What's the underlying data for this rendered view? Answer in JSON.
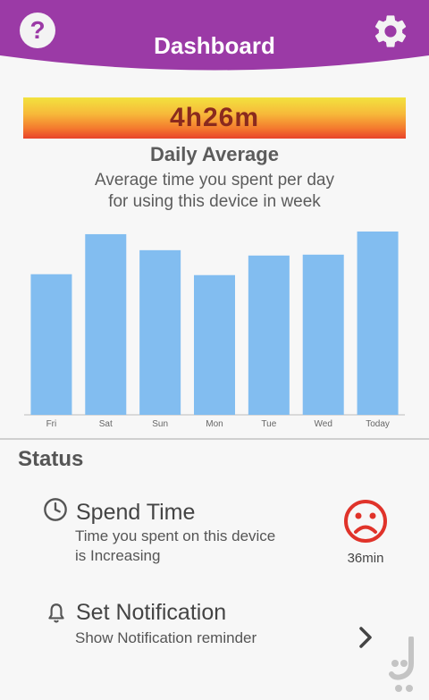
{
  "header": {
    "title": "Dashboard",
    "help_icon": "question-mark-icon",
    "settings_icon": "gear-icon",
    "accent_color": "#9b3aa6"
  },
  "summary": {
    "average_time": "4h26m",
    "heading": "Daily Average",
    "description_line1": "Average time you spent per day",
    "description_line2": "for using this device in week"
  },
  "chart_data": {
    "type": "bar",
    "categories": [
      "Fri",
      "Sat",
      "Sun",
      "Mon",
      "Tue",
      "Wed",
      "Today"
    ],
    "values": [
      158,
      203,
      185,
      157,
      179,
      180,
      206
    ],
    "ylim": [
      0,
      215
    ],
    "grid": false,
    "bar_color": "#82bdf0"
  },
  "status": {
    "heading": "Status",
    "spend_time": {
      "title": "Spend Time",
      "subtitle_line1": "Time you spent on this device",
      "subtitle_line2": "is Increasing",
      "value": "36min",
      "icon": "clock-icon",
      "mood_icon": "sad-face-icon",
      "mood_color": "#e0332a"
    },
    "notification": {
      "title": "Set Notification",
      "subtitle": "Show Notification reminder",
      "icon": "bell-icon",
      "action_icon": "chevron-right-icon"
    }
  }
}
